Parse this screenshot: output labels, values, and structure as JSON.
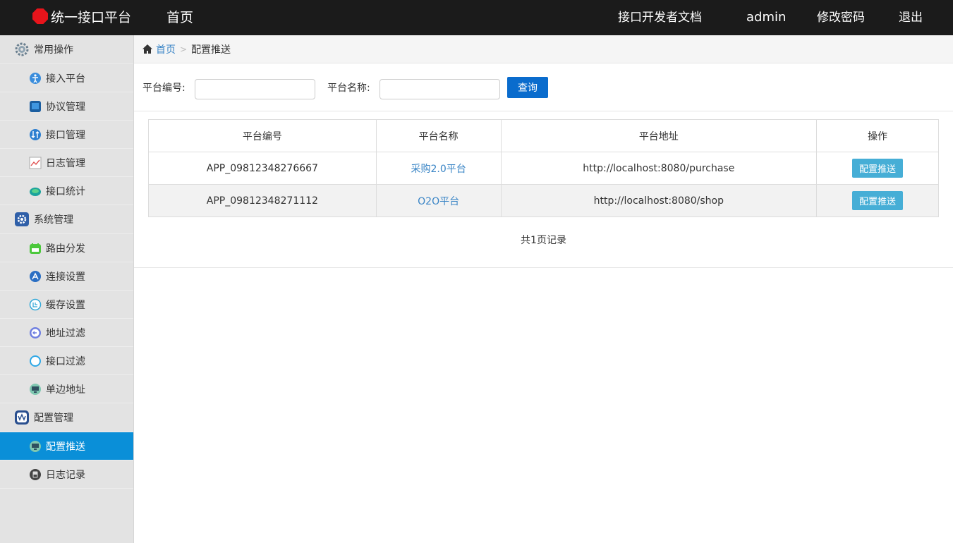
{
  "header": {
    "brand": "统一接口平台",
    "home": "首页",
    "docs": "接口开发者文档",
    "user": "admin",
    "change_password": "修改密码",
    "logout": "退出"
  },
  "sidebar": {
    "groups": [
      {
        "label": "常用操作",
        "icon": "gear-icon",
        "items": [
          {
            "label": "接入平台",
            "icon": "access-icon"
          },
          {
            "label": "协议管理",
            "icon": "protocol-icon"
          },
          {
            "label": "接口管理",
            "icon": "interface-icon"
          },
          {
            "label": "日志管理",
            "icon": "log-chart-icon"
          },
          {
            "label": "接口统计",
            "icon": "stats-icon"
          }
        ]
      },
      {
        "label": "系统管理",
        "icon": "settings-icon",
        "items": [
          {
            "label": "路由分发",
            "icon": "route-icon"
          },
          {
            "label": "连接设置",
            "icon": "connect-icon"
          },
          {
            "label": "缓存设置",
            "icon": "cache-icon"
          },
          {
            "label": "地址过滤",
            "icon": "address-filter-icon"
          },
          {
            "label": "接口过滤",
            "icon": "interface-filter-icon"
          },
          {
            "label": "单边地址",
            "icon": "monitor-icon"
          }
        ]
      },
      {
        "label": "配置管理",
        "icon": "config-icon",
        "items": [
          {
            "label": "配置推送",
            "icon": "push-icon",
            "active": true
          },
          {
            "label": "日志记录",
            "icon": "record-icon"
          }
        ]
      }
    ]
  },
  "breadcrumb": {
    "home": "首页",
    "current": "配置推送"
  },
  "filters": {
    "code_label": "平台编号:",
    "code_value": "",
    "name_label": "平台名称:",
    "name_value": "",
    "query_button": "查询"
  },
  "table": {
    "columns": [
      "平台编号",
      "平台名称",
      "平台地址",
      "操作"
    ],
    "rows": [
      {
        "code": "APP_09812348276667",
        "name": "采购2.0平台",
        "url": "http://localhost:8080/purchase",
        "action": "配置推送"
      },
      {
        "code": "APP_09812348271112",
        "name": "O2O平台",
        "url": "http://localhost:8080/shop",
        "action": "配置推送"
      }
    ]
  },
  "pager": {
    "text": "共1页记录"
  },
  "colors": {
    "topbar": "#1b1b1b",
    "accent": "#0a8fd8",
    "query_button": "#0a6ccd",
    "push_button": "#46aed6",
    "link": "#3a85c6"
  }
}
